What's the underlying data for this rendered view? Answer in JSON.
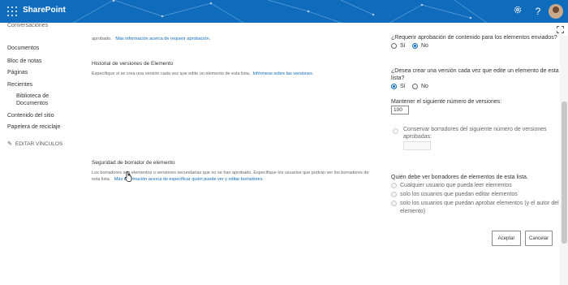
{
  "app": {
    "brand": "SharePoint"
  },
  "topbar": {
    "settings_icon": "gear-icon",
    "help_label": "?",
    "avatar_icon": "avatar"
  },
  "nav": {
    "items": [
      {
        "label": "Conversaciones"
      },
      {
        "label": "Documentos"
      },
      {
        "label": "Bloc de notas"
      },
      {
        "label": "Páginas"
      },
      {
        "label": "Recientes"
      },
      {
        "label": "Biblioteca de"
      },
      {
        "label": "Documentos"
      },
      {
        "label": "Contenido del sitio"
      },
      {
        "label": "Papelera de reciclaje"
      }
    ],
    "edit_links": "EDITAR VÍNCULOS"
  },
  "main": {
    "approval_text": "aprobado.",
    "approval_link": "Más información acerca de requerir aprobación.",
    "versions_title": "Historial de versiones de Elemento",
    "versions_text": "Especifique si se crea una versión cada vez que edite un elemento de esta lista.",
    "versions_link": "Infórmese sobre las versiones.",
    "draft_title": "Seguridad de borrador de elemento",
    "draft_text": "Los borradores son elementos o versiones secundarias que no se han aprobado. Especifique los usuarios que podrán ver los borradores de esta",
    "draft_text2": "lista.",
    "draft_link": "Más información acerca de especificar quién puede ver y editar borradores."
  },
  "right": {
    "approval_question": "¿Requerir aprobación de contenido para los elementos enviados?",
    "approval_yes": "Sí",
    "approval_no": "No",
    "approval_selected": "No",
    "version_question_1": "¿Desea crear una versión cada vez que edite un elemento de esta",
    "version_question_2": "lista?",
    "version_yes": "Sí",
    "version_no": "No",
    "version_selected": "Sí",
    "keep_versions_label": "Mantener el siguiente número de versiones:",
    "keep_versions_value": "100",
    "keep_drafts_label_1": "Conservar borradores del siguiente número de versiones",
    "keep_drafts_label_2": "aprobadas:",
    "draft_question": "Quién debe ver borradores de elementos de esta lista.",
    "draft_opt_1": "Cualquier usuario que pueda leer elementos",
    "draft_opt_2": "solo los usuarios que puedan editar elementos",
    "draft_opt_3a": "solo los usuarios que puedan aprobar elementos (y el autor del",
    "draft_opt_3b": "elemento)"
  },
  "buttons": {
    "accept": "Aceptar",
    "cancel": "Cancelar"
  },
  "colors": {
    "brand": "#0f6cbd"
  }
}
